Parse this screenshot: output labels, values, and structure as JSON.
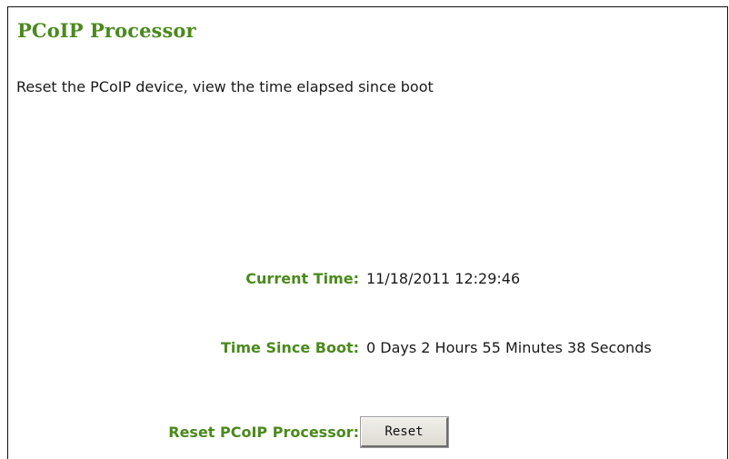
{
  "page": {
    "title": "PCoIP Processor",
    "description": "Reset the PCoIP device, view the time elapsed since boot"
  },
  "fields": {
    "current_time": {
      "label": "Current Time:",
      "value": "11/18/2011 12:29:46"
    },
    "time_since_boot": {
      "label": "Time Since Boot:",
      "value": "0 Days 2 Hours 55 Minutes 38 Seconds"
    },
    "reset_processor": {
      "label": "Reset PCoIP Processor:",
      "button_label": "Reset"
    }
  },
  "colors": {
    "heading_green": "#4a8a1c",
    "text": "#1a1a1a",
    "button_face": "#e8e6df"
  }
}
